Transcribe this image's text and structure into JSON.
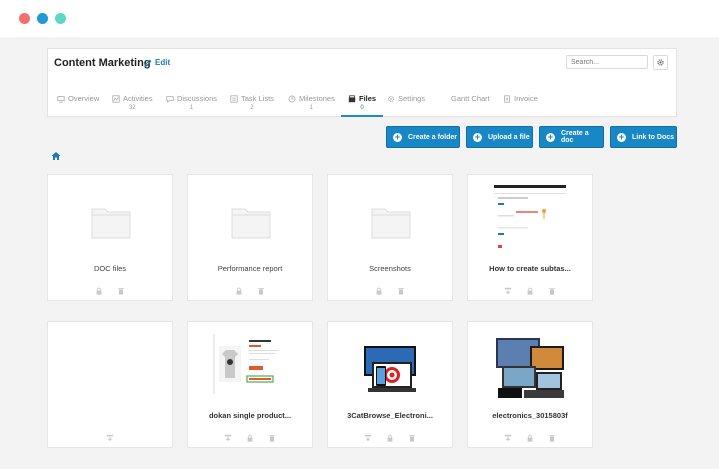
{
  "window": {
    "dots": [
      "#f46e6e",
      "#1f9ad6",
      "#5fd7c6"
    ]
  },
  "project": {
    "title": "Content Marketing",
    "edit_label": "Edit"
  },
  "search": {
    "placeholder": "Search..."
  },
  "tabs": [
    {
      "label": "Overview",
      "count": "",
      "icon": "overview-icon"
    },
    {
      "label": "Activities",
      "count": "32",
      "icon": "activities-icon"
    },
    {
      "label": "Discussions",
      "count": "1",
      "icon": "discussions-icon"
    },
    {
      "label": "Task Lists",
      "count": "2",
      "icon": "task-lists-icon"
    },
    {
      "label": "Milestones",
      "count": "1",
      "icon": "milestones-icon"
    },
    {
      "label": "Files",
      "count": "0",
      "icon": "files-icon",
      "active": true
    },
    {
      "label": "Settings",
      "count": "",
      "icon": "settings-icon"
    },
    {
      "label": "Gantt Chart",
      "count": "",
      "icon": ""
    },
    {
      "label": "Invoice",
      "count": "",
      "icon": "invoice-icon"
    }
  ],
  "actions": [
    {
      "label": "Create a folder"
    },
    {
      "label": "Upload a file"
    },
    {
      "label": "Create a doc"
    },
    {
      "label": "Link to Docs"
    }
  ],
  "cards": [
    {
      "name": "DOC files",
      "kind": "folder",
      "icons": [
        "lock-icon",
        "trash-icon"
      ]
    },
    {
      "name": "Performance report",
      "kind": "folder",
      "icons": [
        "lock-icon",
        "trash-icon"
      ]
    },
    {
      "name": "Screenshots",
      "kind": "folder",
      "icons": [
        "lock-icon",
        "trash-icon"
      ]
    },
    {
      "name": "How to create subtas...",
      "kind": "image",
      "icons": [
        "download-icon",
        "lock-icon",
        "trash-icon"
      ]
    },
    {
      "name": "",
      "kind": "blank",
      "icons": [
        "download-icon"
      ]
    },
    {
      "name": "dokan single product...",
      "kind": "image",
      "icons": [
        "download-icon",
        "lock-icon",
        "trash-icon"
      ]
    },
    {
      "name": "3CatBrowse_Electroni...",
      "kind": "image",
      "icons": [
        "download-icon",
        "lock-icon",
        "trash-icon"
      ]
    },
    {
      "name": "electronics_3015803f",
      "kind": "image",
      "icons": [
        "download-icon",
        "lock-icon",
        "trash-icon"
      ]
    }
  ],
  "colors": {
    "accent": "#1787c5",
    "background": "#f3f3f4"
  }
}
